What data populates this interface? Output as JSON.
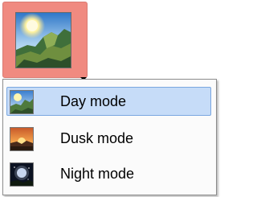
{
  "theme_button": {
    "icon": "day-landscape-icon",
    "accent_color": "#f08a80"
  },
  "menu": {
    "items": [
      {
        "label": "Day mode",
        "icon": "day-landscape-icon",
        "selected": true
      },
      {
        "label": "Dusk mode",
        "icon": "dusk-landscape-icon",
        "selected": false
      },
      {
        "label": "Night mode",
        "icon": "night-moon-icon",
        "selected": false
      }
    ],
    "selected_background": "#c6dcf8",
    "selected_border": "#7aa7e0"
  }
}
